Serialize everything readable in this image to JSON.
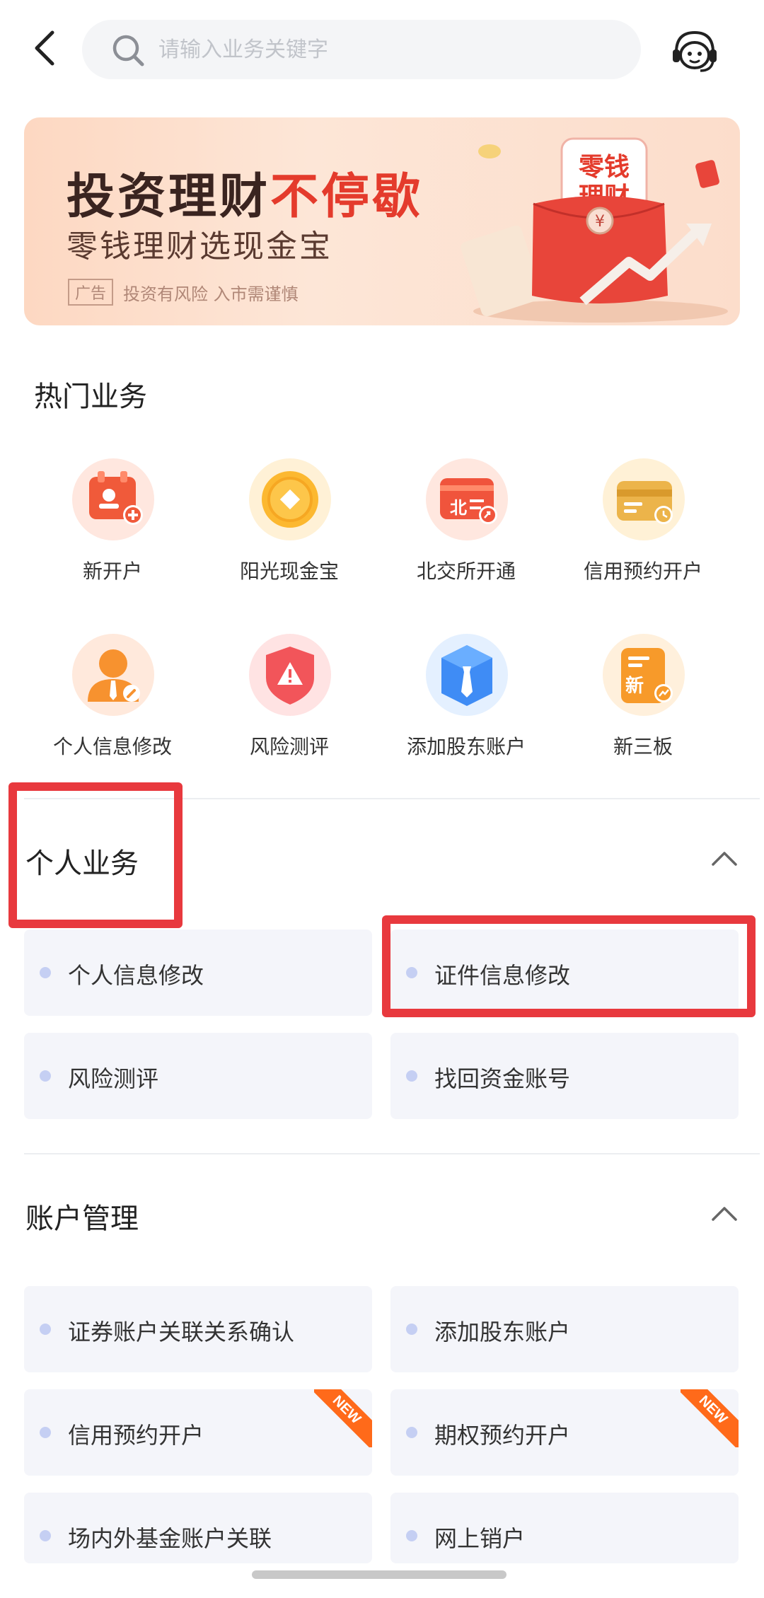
{
  "header": {
    "search_placeholder": "请输入业务关键字"
  },
  "banner": {
    "title_part1": "投资理财",
    "title_part2": "不停歇",
    "subtitle": "零钱理财选现金宝",
    "ad_tag": "广告",
    "ad_text": "投资有风险  入市需谨慎",
    "art_text_1": "零钱",
    "art_text_2": "理财",
    "art_currency": "¥"
  },
  "hot": {
    "title": "热门业务",
    "items": [
      {
        "label": "新开户",
        "icon": "new-account-icon"
      },
      {
        "label": "阳光现金宝",
        "icon": "cash-treasure-icon"
      },
      {
        "label": "北交所开通",
        "icon": "bse-open-icon"
      },
      {
        "label": "信用预约开户",
        "icon": "credit-account-icon"
      },
      {
        "label": "个人信息修改",
        "icon": "personal-info-icon"
      },
      {
        "label": "风险测评",
        "icon": "risk-assessment-icon"
      },
      {
        "label": "添加股东账户",
        "icon": "add-shareholder-icon"
      },
      {
        "label": "新三板",
        "icon": "neeq-icon"
      }
    ],
    "icon_texts": {
      "bse": "北",
      "neeq": "新"
    }
  },
  "personal": {
    "title": "个人业务",
    "items": [
      "个人信息修改",
      "证件信息修改",
      "风险测评",
      "找回资金账号"
    ]
  },
  "account": {
    "title": "账户管理",
    "items": [
      "证券账户关联关系确认",
      "添加股东账户",
      "信用预约开户",
      "期权预约开户",
      "场内外基金账户关联",
      "网上销户"
    ],
    "new_badge": "NEW"
  },
  "colors": {
    "accent_red": "#e43b2c",
    "highlight_box": "#e8393e",
    "card_bg": "#f4f5fa",
    "dot": "#c5cff3",
    "new_badge": "#ff6a1a"
  }
}
